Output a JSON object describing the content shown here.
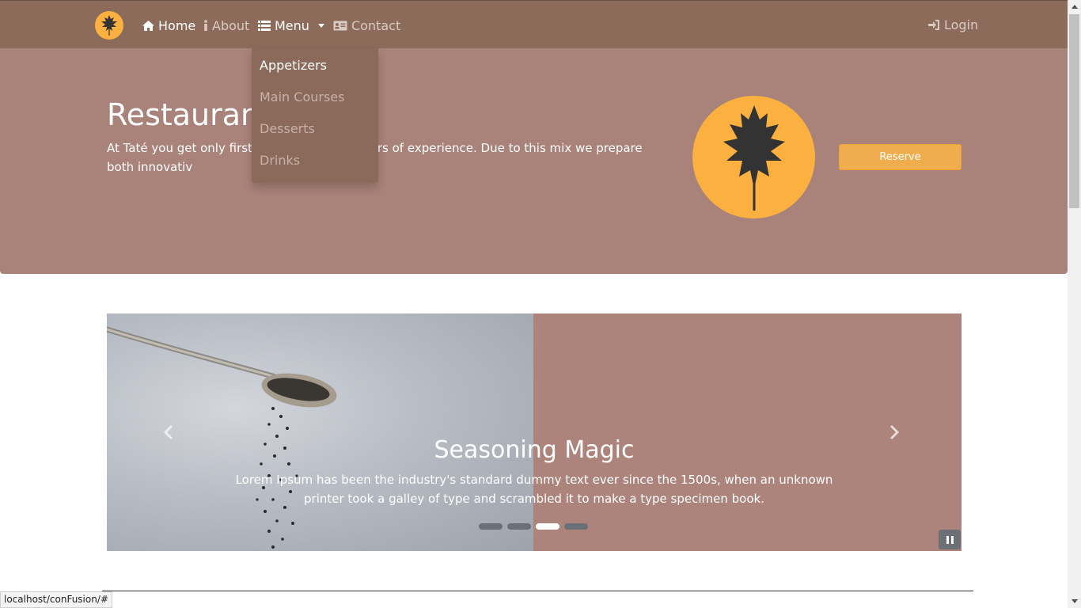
{
  "navbar": {
    "brand_icon": "leaf-logo-icon",
    "items": [
      {
        "label": "Home",
        "icon": "home-icon",
        "active": true
      },
      {
        "label": "About",
        "icon": "info-icon",
        "active": false
      },
      {
        "label": "Menu",
        "icon": "list-icon",
        "active": false
      },
      {
        "label": "Contact",
        "icon": "address-card-icon",
        "active": false
      }
    ],
    "login_label": "Login"
  },
  "menu_dropdown": {
    "items": [
      "Appetizers",
      "Main Courses",
      "Desserts",
      "Drinks"
    ]
  },
  "jumbotron": {
    "title": "Restaurant",
    "text": "At Taté you get only first-c                                d our chef has years of experience. Due to this mix we prepare both innovativ",
    "reserve_label": "Reserve"
  },
  "carousel": {
    "slide_title": "Seasoning Magic",
    "slide_text": "Lorem Ipsum has been the industry's standard dummy text ever since the 1500s, when an unknown printer took a galley of type and scrambled it to make a type specimen book.",
    "indicator_count": 4,
    "active_indicator": 2
  },
  "status_bar": {
    "url": "localhost/conFusion/#"
  },
  "colors": {
    "navbar": "#8c6b5b",
    "jumbotron": "#a9837a",
    "accent": "#fbb040",
    "reserve": "#f0ad4e"
  }
}
